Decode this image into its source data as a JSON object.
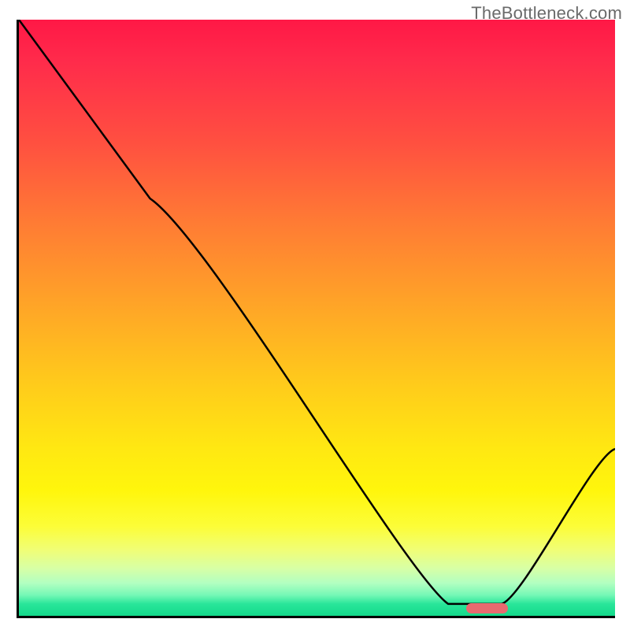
{
  "watermark": "TheBottleneck.com",
  "chart_data": {
    "type": "line",
    "title": "",
    "xlabel": "",
    "ylabel": "",
    "xlim": [
      0,
      100
    ],
    "ylim": [
      0,
      100
    ],
    "grid": false,
    "background_gradient": {
      "top_color": "#ff1846",
      "mid_color": "#ffe812",
      "bottom_color": "#13d98a"
    },
    "series": [
      {
        "name": "bottleneck-curve",
        "x": [
          0,
          22,
          72,
          76,
          81,
          100
        ],
        "y": [
          100,
          70,
          2,
          2,
          2,
          28
        ]
      }
    ],
    "annotations": [
      {
        "name": "optimal-marker",
        "shape": "pill",
        "color": "#e86a6f",
        "x_start": 75,
        "x_end": 82,
        "y": 1.3
      }
    ]
  }
}
